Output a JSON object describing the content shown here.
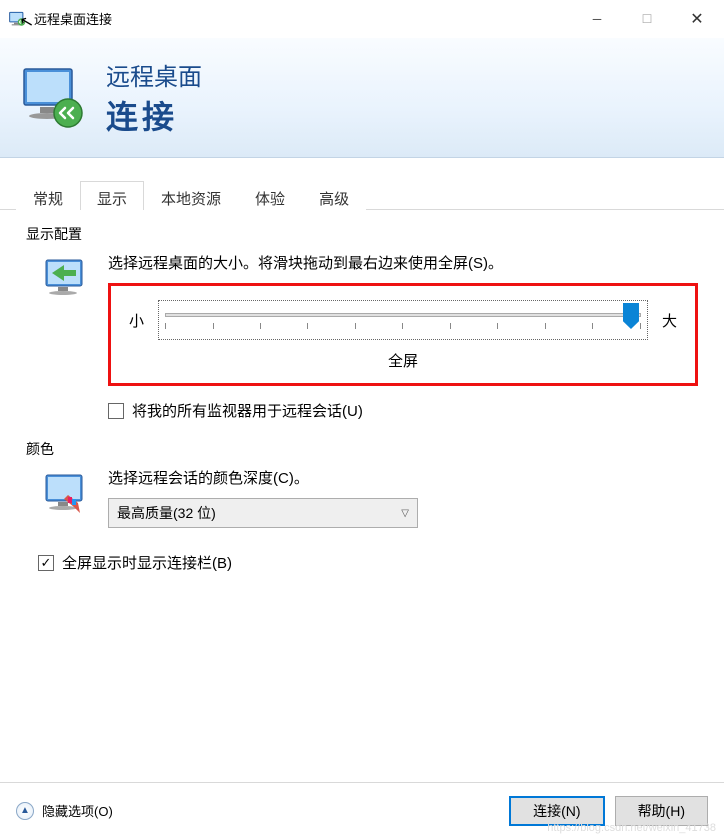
{
  "window": {
    "title": "远程桌面连接"
  },
  "header": {
    "line1": "远程桌面",
    "line2": "连接"
  },
  "tabs": {
    "items": [
      "常规",
      "显示",
      "本地资源",
      "体验",
      "高级"
    ],
    "active_index": 1
  },
  "display_config": {
    "title": "显示配置",
    "description": "选择远程桌面的大小。将滑块拖动到最右边来使用全屏(S)。",
    "slider": {
      "min_label": "小",
      "max_label": "大",
      "current_label": "全屏"
    },
    "checkbox_label": "将我的所有监视器用于远程会话(U)",
    "checkbox_checked": false
  },
  "color": {
    "title": "颜色",
    "description": "选择远程会话的颜色深度(C)。",
    "dropdown_value": "最高质量(32 位)"
  },
  "fullscreen_bar": {
    "label": "全屏显示时显示连接栏(B)",
    "checked": true
  },
  "footer": {
    "hide_options": "隐藏选项(O)",
    "connect": "连接(N)",
    "help": "帮助(H)"
  },
  "watermark": "https://blog.csdn.net/weixin_41738"
}
